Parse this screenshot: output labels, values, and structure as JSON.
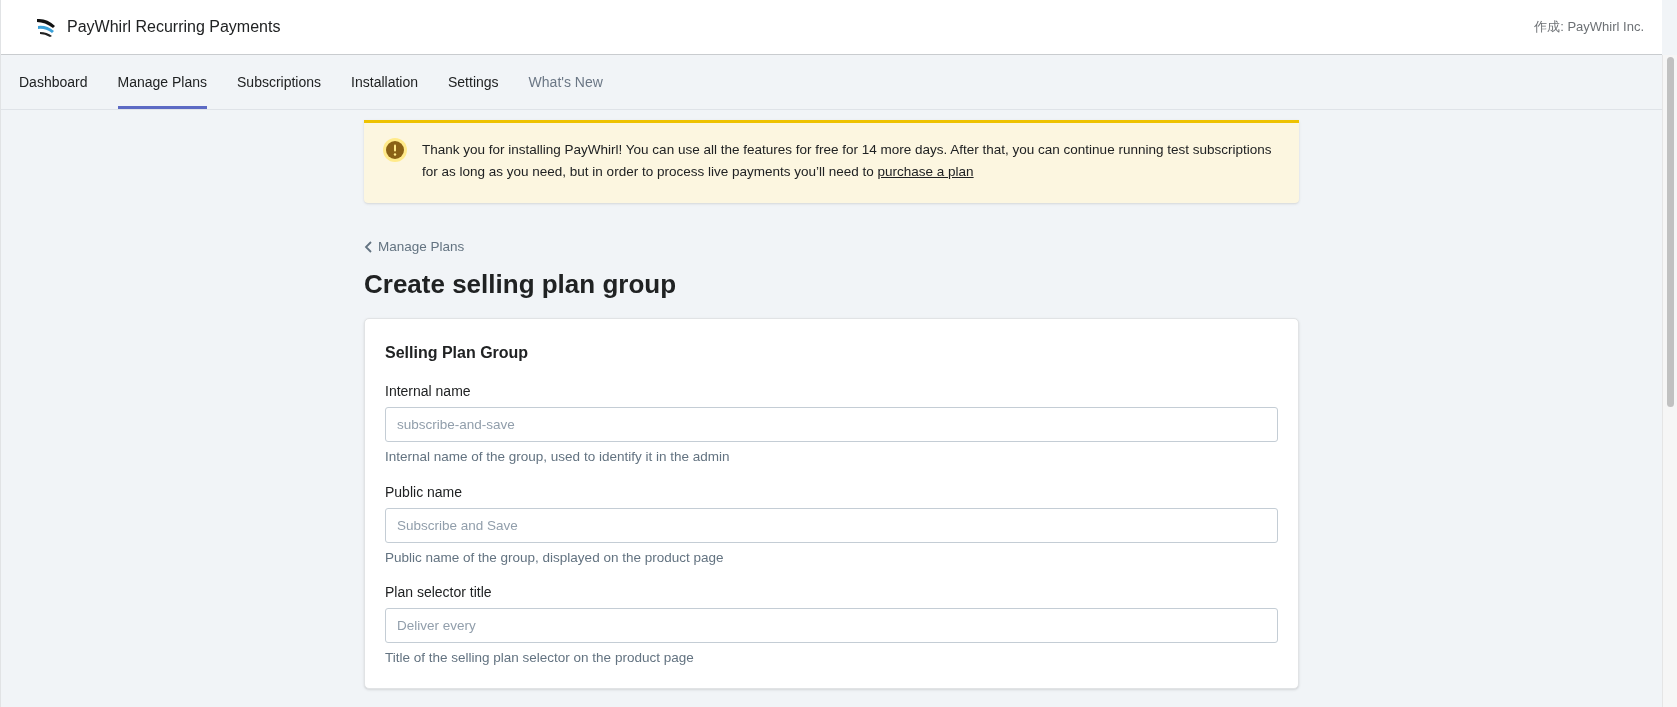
{
  "header": {
    "app_title": "PayWhirl Recurring Payments",
    "author": "作成: PayWhirl Inc."
  },
  "tabs": [
    {
      "label": "Dashboard",
      "selected": false,
      "dimmed": false
    },
    {
      "label": "Manage Plans",
      "selected": true,
      "dimmed": false
    },
    {
      "label": "Subscriptions",
      "selected": false,
      "dimmed": false
    },
    {
      "label": "Installation",
      "selected": false,
      "dimmed": false
    },
    {
      "label": "Settings",
      "selected": false,
      "dimmed": false
    },
    {
      "label": "What's New",
      "selected": false,
      "dimmed": true
    }
  ],
  "banner": {
    "text": "Thank you for installing PayWhirl! You can use all the features for free for 14 more days. After that, you can continue running test subscriptions for as long as you need, but in order to process live payments you’ll need to",
    "link": "purchase a plan"
  },
  "breadcrumb": "Manage Plans",
  "page_title": "Create selling plan group",
  "card": {
    "title": "Selling Plan Group",
    "fields": [
      {
        "label": "Internal name",
        "placeholder": "subscribe-and-save",
        "help": "Internal name of the group, used to identify it in the admin"
      },
      {
        "label": "Public name",
        "placeholder": "Subscribe and Save",
        "help": "Public name of the group, displayed on the product page"
      },
      {
        "label": "Plan selector title",
        "placeholder": "Deliver every",
        "help": "Title of the selling plan selector on the product page"
      }
    ]
  }
}
